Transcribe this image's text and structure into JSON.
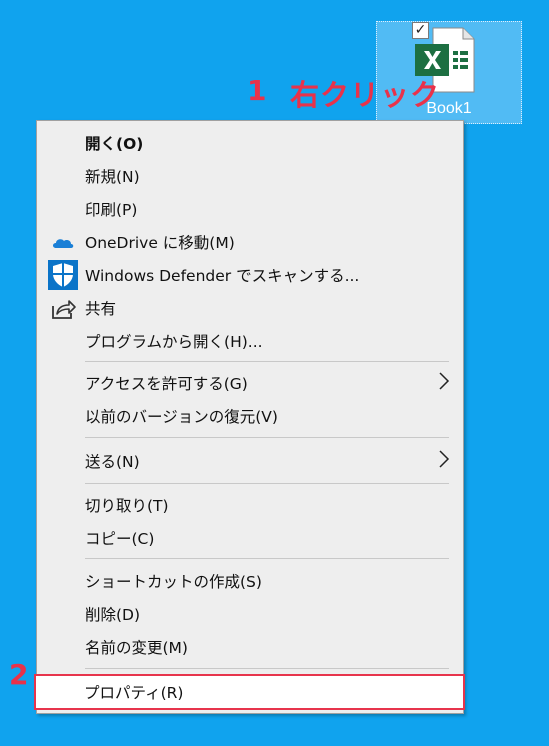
{
  "desktop": {
    "file": {
      "name": "Book1",
      "checked_mark": "✓"
    }
  },
  "annotations": {
    "step1_number": "1",
    "step1_text": "右クリック",
    "step2_number": "2"
  },
  "menu": {
    "items": [
      {
        "id": "open",
        "label": "開く(O)",
        "bold": true
      },
      {
        "id": "new",
        "label": "新規(N)"
      },
      {
        "id": "print",
        "label": "印刷(P)"
      },
      {
        "id": "onedrive",
        "label": "OneDrive に移動(M)",
        "icon": "onedrive-cloud-icon"
      },
      {
        "id": "defender",
        "label": "Windows Defender でスキャンする...",
        "icon": "defender-shield-icon"
      },
      {
        "id": "share",
        "label": "共有",
        "icon": "share-icon"
      },
      {
        "id": "openwith",
        "label": "プログラムから開く(H)..."
      },
      {
        "id": "giveaccess",
        "label": "アクセスを許可する(G)",
        "submenu": true
      },
      {
        "id": "restore",
        "label": "以前のバージョンの復元(V)"
      },
      {
        "id": "sendto",
        "label": "送る(N)",
        "submenu": true
      },
      {
        "id": "cut",
        "label": "切り取り(T)"
      },
      {
        "id": "copy",
        "label": "コピー(C)"
      },
      {
        "id": "shortcut",
        "label": "ショートカットの作成(S)"
      },
      {
        "id": "delete",
        "label": "削除(D)"
      },
      {
        "id": "rename",
        "label": "名前の変更(M)"
      },
      {
        "id": "properties",
        "label": "プロパティ(R)"
      }
    ]
  },
  "colors": {
    "desktop_bg": "#10a3ee",
    "menu_bg": "#eeeeee",
    "annotation": "#e9324a",
    "excel_green": "#1d6f42"
  }
}
